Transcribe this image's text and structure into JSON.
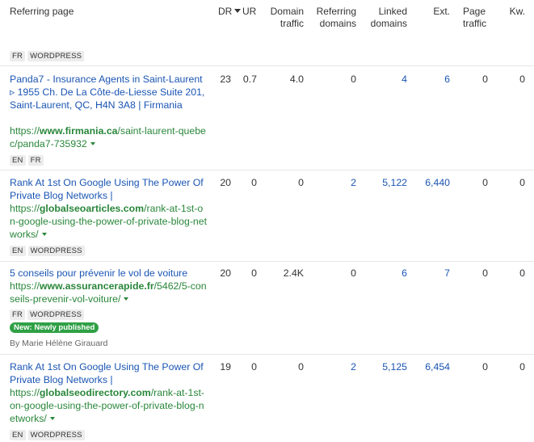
{
  "columns": {
    "page": "Referring page",
    "dr": "DR",
    "ur": "UR",
    "traffic": [
      "Domain",
      "traffic"
    ],
    "ref_domains": [
      "Referring",
      "domains"
    ],
    "linked_domains": [
      "Linked",
      "domains"
    ],
    "ext": "Ext.",
    "page_traffic": [
      "Page",
      "traffic"
    ],
    "kw": "Kw."
  },
  "top_row_tags": [
    "FR",
    "WORDPRESS"
  ],
  "rows": [
    {
      "title": "Panda7 - Insurance Agents in Saint-Laurent ▹ 1955 Ch. De La Côte-de-Liesse Suite 201, Saint-Laurent, QC, H4N 3A8 | Firmania",
      "url_prefix": "https://",
      "url_domain": "www.firmania.ca",
      "url_path": "/saint-laurent-quebec/panda7-735932",
      "tags": [
        "EN",
        "FR"
      ],
      "dr": "23",
      "ur": "0.7",
      "traffic": "4.0",
      "ref_domains": "0",
      "linked_domains": "4",
      "ext": "6",
      "page_traffic": "0",
      "kw": "0"
    },
    {
      "title": "Rank At 1st On Google Using The Power Of Private Blog Networks |",
      "url_prefix": "https://",
      "url_domain": "globalseoarticles.com",
      "url_path": "/rank-at-1st-on-google-using-the-power-of-private-blog-networks/",
      "tags": [
        "EN",
        "WORDPRESS"
      ],
      "dr": "20",
      "ur": "0",
      "traffic": "0",
      "ref_domains": "2",
      "linked_domains": "5,122",
      "ext": "6,440",
      "page_traffic": "0",
      "kw": "0"
    },
    {
      "title": "5 conseils pour prévenir le vol de voiture",
      "url_prefix": "https://",
      "url_domain": "www.assurancerapide.fr",
      "url_path": "/5462/5-conseils-prevenir-vol-voiture/",
      "tags": [
        "FR",
        "WORDPRESS"
      ],
      "badge": "New: Newly published",
      "author": "By Marie Hélène Girauard",
      "dr": "20",
      "ur": "0",
      "traffic": "2.4K",
      "ref_domains": "0",
      "linked_domains": "6",
      "ext": "7",
      "page_traffic": "0",
      "kw": "0"
    },
    {
      "title": "Rank At 1st On Google Using The Power Of Private Blog Networks |",
      "url_prefix": "https://",
      "url_domain": "globalseodirectory.com",
      "url_path": "/rank-at-1st-on-google-using-the-power-of-private-blog-networks/",
      "tags": [
        "EN",
        "WORDPRESS"
      ],
      "dr": "19",
      "ur": "0",
      "traffic": "0",
      "ref_domains": "2",
      "linked_domains": "5,125",
      "ext": "6,454",
      "page_traffic": "0",
      "kw": "0"
    }
  ]
}
